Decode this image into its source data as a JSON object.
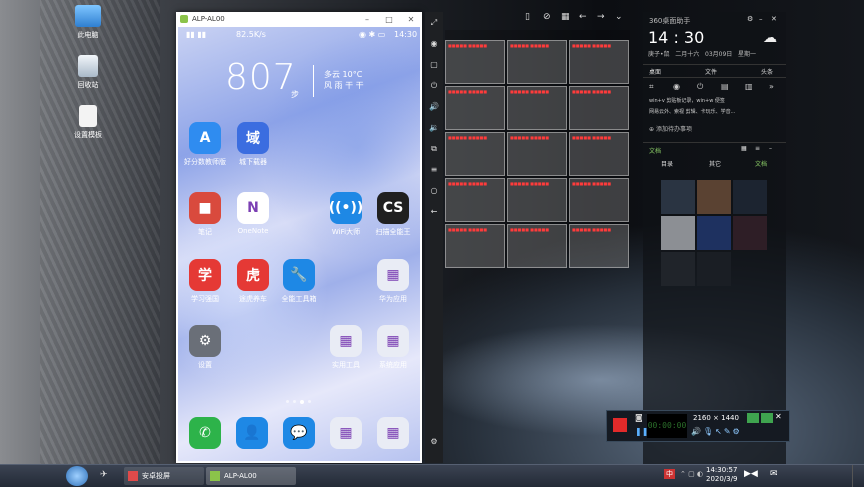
{
  "desktop": {
    "icons": [
      {
        "label": "此电脑",
        "icon": "computer-icon"
      },
      {
        "label": "回收站",
        "icon": "recycle-bin-icon"
      },
      {
        "label": "设置模板",
        "icon": "document-icon"
      }
    ]
  },
  "phone_window": {
    "title": "ALP-AL00",
    "status": {
      "speed": "82.5K/s",
      "time": "14:30",
      "battery": "■"
    },
    "steps": "807",
    "steps_unit": "步",
    "weather": {
      "cond": "多云",
      "temp": "10°C",
      "line2": "风 雨 干 干"
    },
    "apps": [
      {
        "label": "好分数教师版",
        "color": "#2f8cf0",
        "glyph": "A"
      },
      {
        "label": "城下载器",
        "color": "#3b6de0",
        "glyph": "域"
      },
      {
        "label": "笔记",
        "color": "#d94a3d",
        "glyph": "■"
      },
      {
        "label": "OneNote",
        "color": "#ffffff",
        "glyph": "N"
      },
      {
        "label": "WiFi大师",
        "color": "#1e88e5",
        "glyph": "((•))"
      },
      {
        "label": "扫描全能王",
        "color": "#202020",
        "glyph": "CS"
      },
      {
        "label": "学习强国",
        "color": "#e53935",
        "glyph": "学"
      },
      {
        "label": "途虎养车",
        "color": "#e53935",
        "glyph": "虎"
      },
      {
        "label": "全能工具箱",
        "color": "#1e88e5",
        "glyph": "🔧"
      },
      {
        "label": "华为应用",
        "color": "#e9ecf5",
        "glyph": "▦"
      },
      {
        "label": "设置",
        "color": "#6a6f78",
        "glyph": "⚙"
      },
      {
        "label": "实用工具",
        "color": "#e9ecf5",
        "glyph": "▦"
      },
      {
        "label": "系统应用",
        "color": "#e9ecf5",
        "glyph": "▦"
      }
    ],
    "dock": [
      {
        "label": "phone",
        "color": "#2db34a",
        "glyph": "✆"
      },
      {
        "label": "contacts",
        "color": "#1e88e5",
        "glyph": "👤"
      },
      {
        "label": "messages",
        "color": "#1e88e5",
        "glyph": "💬"
      },
      {
        "label": "folder",
        "color": "#e9ecf5",
        "glyph": "▦"
      },
      {
        "label": "folder2",
        "color": "#e9ecf5",
        "glyph": "▦"
      }
    ]
  },
  "grid_overlay": {
    "cell_text": "■■■■■ ■■■■■"
  },
  "panel": {
    "title": "360桌面助手",
    "time": "14 : 30",
    "date_line": [
      "庚子•鼠",
      "二月十六",
      "03月09日",
      "星期一"
    ],
    "tabs": [
      "桌面",
      "文件",
      "头条"
    ],
    "items": [
      "win+v 剪贴板记录，win+w 便签",
      "网易云外、索视 剪辑、卡玩乐、学音..."
    ],
    "add_todo": "添加待办事项",
    "section_title": "文档",
    "sub_tabs": [
      "目录",
      "其它",
      "文档"
    ]
  },
  "recorder": {
    "resolution": "2160 × 1440",
    "timer": "00:00:00"
  },
  "taskbar": {
    "items": [
      {
        "label": "安卓投屏"
      },
      {
        "label": "ALP-AL00"
      }
    ],
    "clock_time": "14:30:57",
    "clock_date": "2020/3/9",
    "ime": "中"
  }
}
